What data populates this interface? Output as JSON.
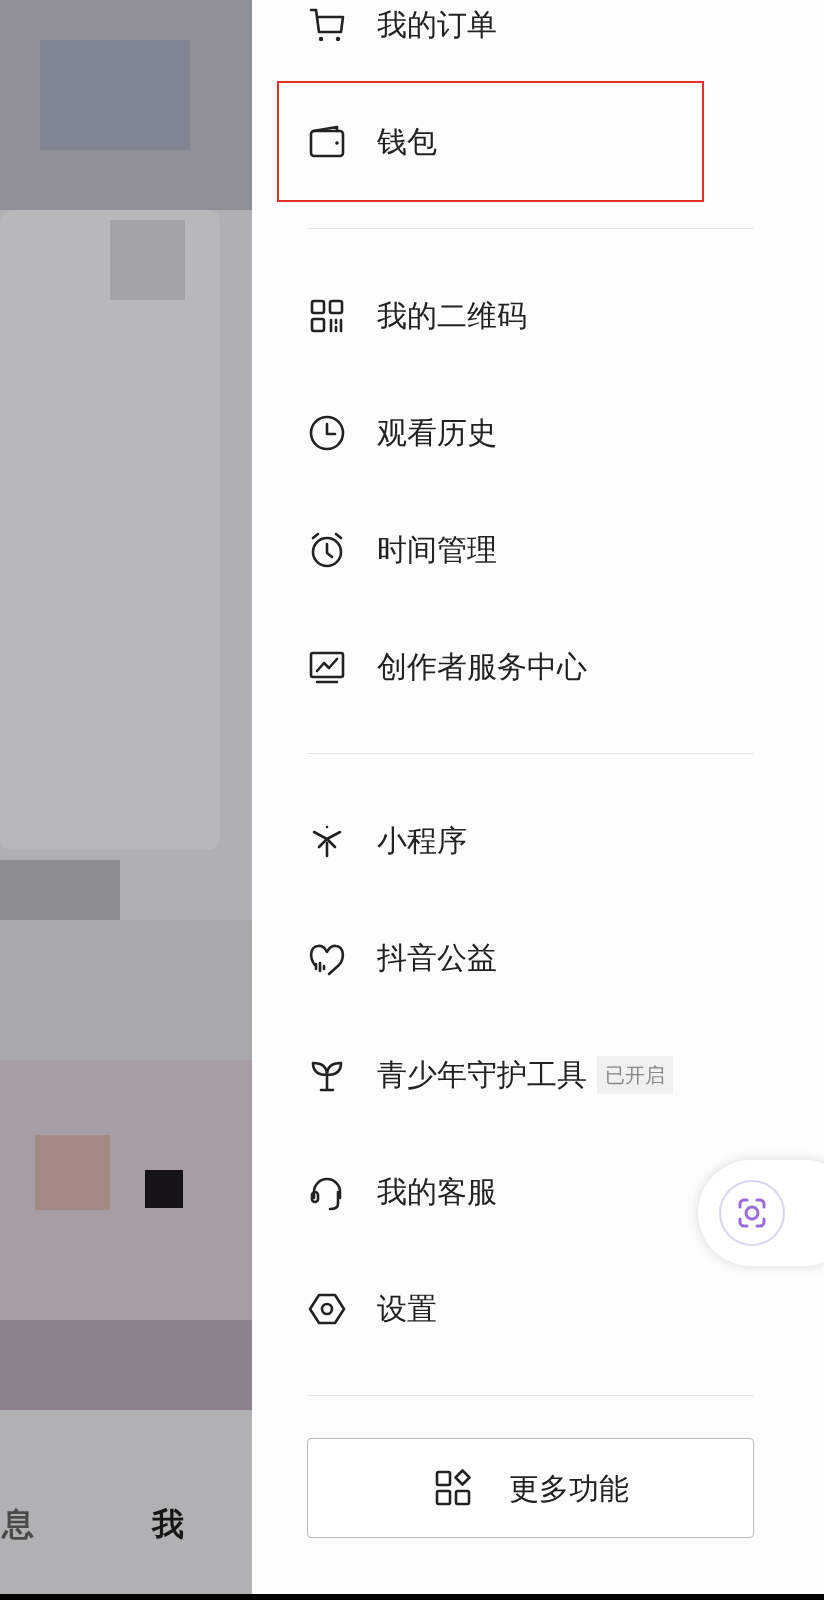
{
  "sections": [
    {
      "items": [
        {
          "kind": "cart",
          "label": "我的订单",
          "highlighted": false
        },
        {
          "kind": "wallet",
          "label": "钱包",
          "highlighted": true
        }
      ]
    },
    {
      "items": [
        {
          "kind": "qr",
          "label": "我的二维码",
          "highlighted": false
        },
        {
          "kind": "clock",
          "label": "观看历史",
          "highlighted": false
        },
        {
          "kind": "alarm",
          "label": "时间管理",
          "highlighted": false
        },
        {
          "kind": "monitor",
          "label": "创作者服务中心",
          "highlighted": false
        }
      ]
    },
    {
      "items": [
        {
          "kind": "spark",
          "label": "小程序",
          "highlighted": false
        },
        {
          "kind": "heart",
          "label": "抖音公益",
          "highlighted": false
        },
        {
          "kind": "sprout",
          "label": "青少年守护工具",
          "badge": "已开启",
          "highlighted": false
        },
        {
          "kind": "headset",
          "label": "我的客服",
          "highlighted": false
        },
        {
          "kind": "hexagon",
          "label": "设置",
          "highlighted": false
        }
      ]
    }
  ],
  "more_button": {
    "label": "更多功能"
  },
  "bottom_tabs": [
    {
      "label": "息",
      "selected": false
    },
    {
      "label": "我",
      "selected": true
    }
  ]
}
